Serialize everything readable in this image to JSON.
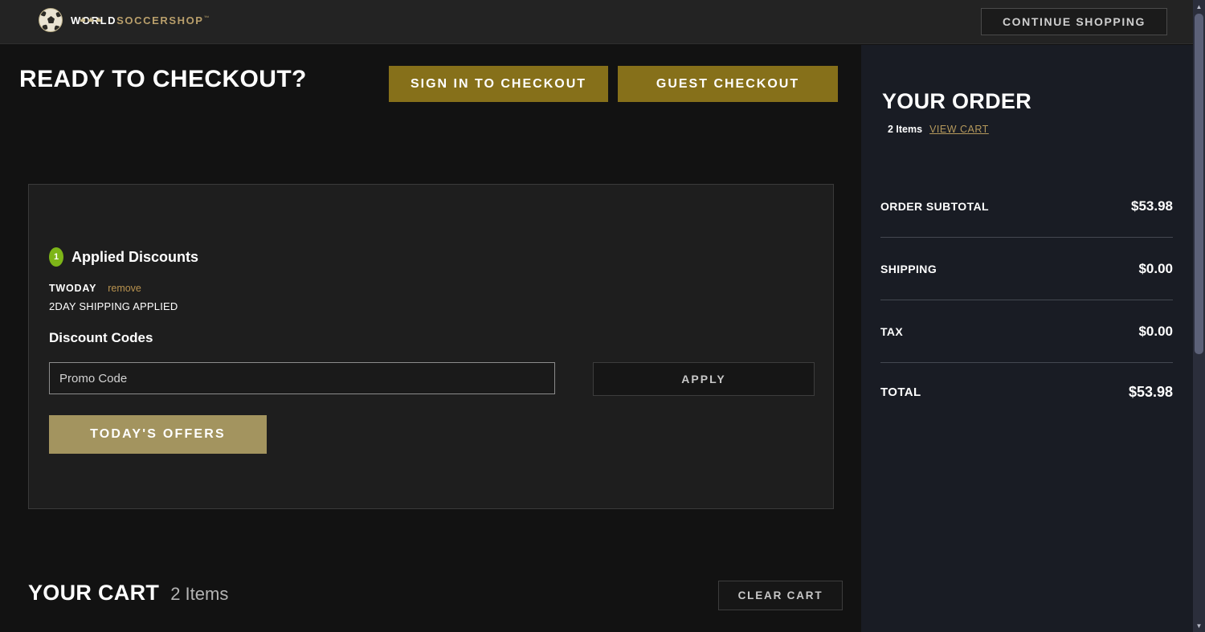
{
  "header": {
    "logo": {
      "word_white": "WORLD",
      "word_gold": "SOCCERSHOP",
      "trademark": "™",
      "icon": "soccer-ball-icon"
    },
    "continue_shopping": "CONTINUE SHOPPING"
  },
  "checkout_bar": {
    "heading": "READY TO CHECKOUT?",
    "sign_in_button": "SIGN IN TO CHECKOUT",
    "guest_button": "GUEST CHECKOUT"
  },
  "discounts": {
    "badge_count": "1",
    "applied_title": "Applied Discounts",
    "applied_code": "TWODAY",
    "remove_label": "remove",
    "applied_description": "2DAY SHIPPING APPLIED",
    "section_title": "Discount Codes",
    "promo_placeholder": "Promo Code",
    "promo_value": "",
    "apply_button": "APPLY",
    "offers_button": "TODAY'S OFFERS"
  },
  "cart": {
    "title": "YOUR CART",
    "item_count": "2 Items",
    "clear_button": "CLEAR CART"
  },
  "order": {
    "title": "YOUR ORDER",
    "item_count": "2 Items",
    "view_cart": "VIEW CART",
    "rows": [
      {
        "label": "ORDER SUBTOTAL",
        "value": "$53.98"
      },
      {
        "label": "SHIPPING",
        "value": "$0.00"
      },
      {
        "label": "TAX",
        "value": "$0.00"
      },
      {
        "label": "TOTAL",
        "value": "$53.98"
      }
    ]
  },
  "scrollbar": {
    "up_icon": "chevron-up-icon",
    "down_icon": "chevron-down-icon"
  },
  "colors": {
    "page_bg": "#121212",
    "header_bg": "#232323",
    "panel_bg": "#191c24",
    "card_bg": "#1e1e1e",
    "gold_button": "#86701a",
    "khaki_button": "#a3945f",
    "badge_green": "#7db518",
    "link_gold": "#b5995c"
  }
}
